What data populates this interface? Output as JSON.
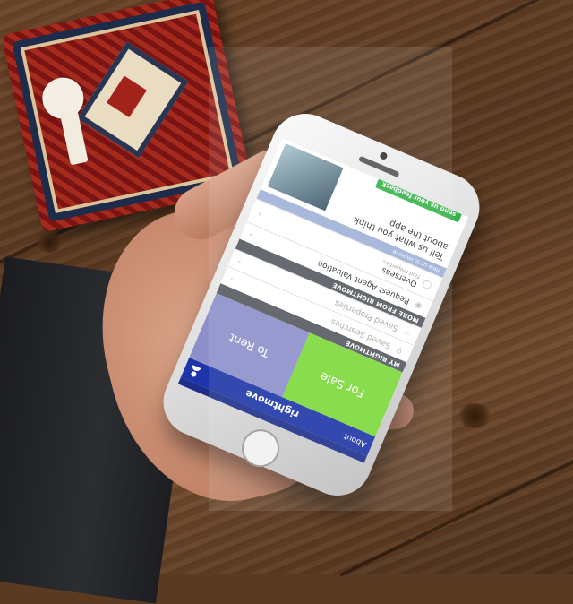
{
  "app": {
    "header_about": "About",
    "header_logo": "rightmove",
    "tile_sale": "For Sale",
    "tile_rent": "To Rent",
    "section_my": "MY RIGHTMOVE",
    "saved_searches": "Saved Searches",
    "saved_properties": "Saved Properties",
    "section_more": "MORE FROM RIGHTMOVE",
    "agent_valuation": "Request Agent Valuation",
    "overseas": "Overseas",
    "overseas_sub": "Find Properties",
    "feedback_head": "Help us to improve",
    "feedback_text": "Tell us what you think about the app",
    "feedback_button": "send us your feedback"
  },
  "colors": {
    "header": "#1d35a8",
    "for_sale": "#7bd83a",
    "to_rent": "#8c8fc9",
    "feedback_button": "#37b34a"
  },
  "icons": {
    "header_left": "user-icon",
    "saved_searches": "search-icon",
    "saved_properties": "star-icon",
    "valuation": "pin-icon"
  }
}
